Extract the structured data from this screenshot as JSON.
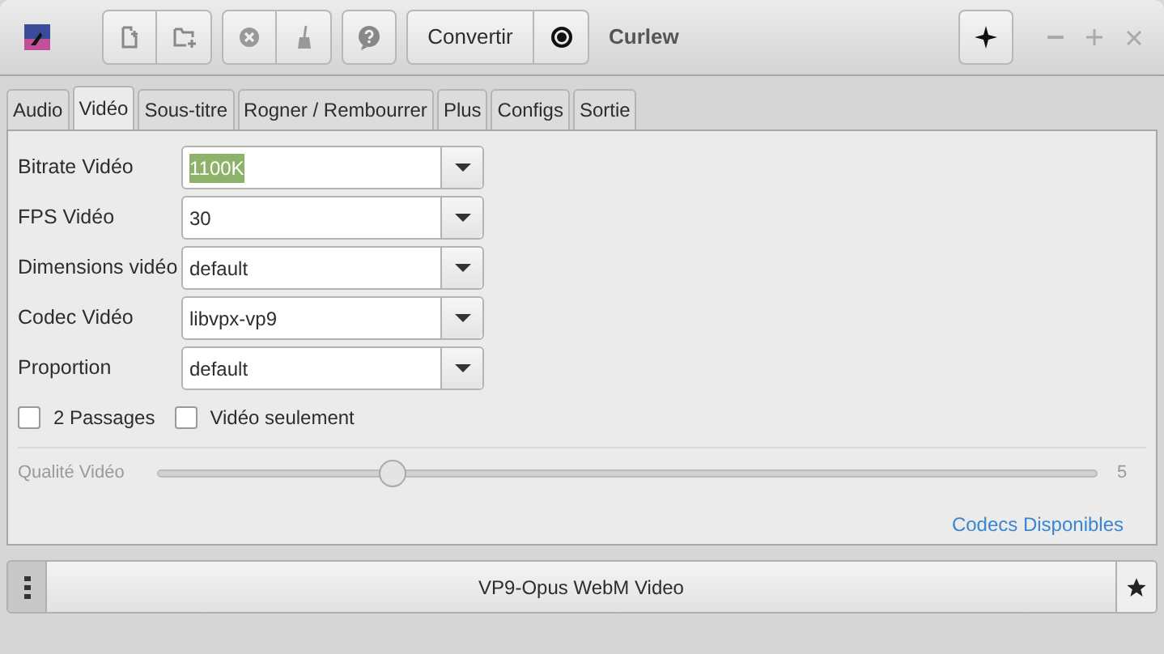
{
  "window": {
    "title": "Curlew"
  },
  "toolbar": {
    "convert_label": "Convertir"
  },
  "tabs": [
    {
      "label": "Audio",
      "selected": false
    },
    {
      "label": "Vidéo",
      "selected": true
    },
    {
      "label": "Sous-titre",
      "selected": false
    },
    {
      "label": "Rogner / Rembourrer",
      "selected": false
    },
    {
      "label": "Plus",
      "selected": false
    },
    {
      "label": "Configs",
      "selected": false
    },
    {
      "label": "Sortie",
      "selected": false
    }
  ],
  "fields": [
    {
      "label": "Bitrate Vidéo",
      "value": "1100K",
      "highlighted": true
    },
    {
      "label": "FPS Vidéo",
      "value": "30",
      "highlighted": false
    },
    {
      "label": "Dimensions vidéo",
      "value": "default",
      "highlighted": false
    },
    {
      "label": "Codec Vidéo",
      "value": "libvpx-vp9",
      "highlighted": false
    },
    {
      "label": "Proportion",
      "value": "default",
      "highlighted": false
    }
  ],
  "checkboxes": [
    {
      "label": "2 Passages",
      "checked": false
    },
    {
      "label": "Vidéo seulement",
      "checked": false
    }
  ],
  "quality": {
    "label": "Qualité Vidéo",
    "level": 0.25,
    "reading": "5",
    "disabled": true
  },
  "link": "Codecs Disponibles",
  "format": {
    "label": "VP9-Opus WebM Video"
  }
}
